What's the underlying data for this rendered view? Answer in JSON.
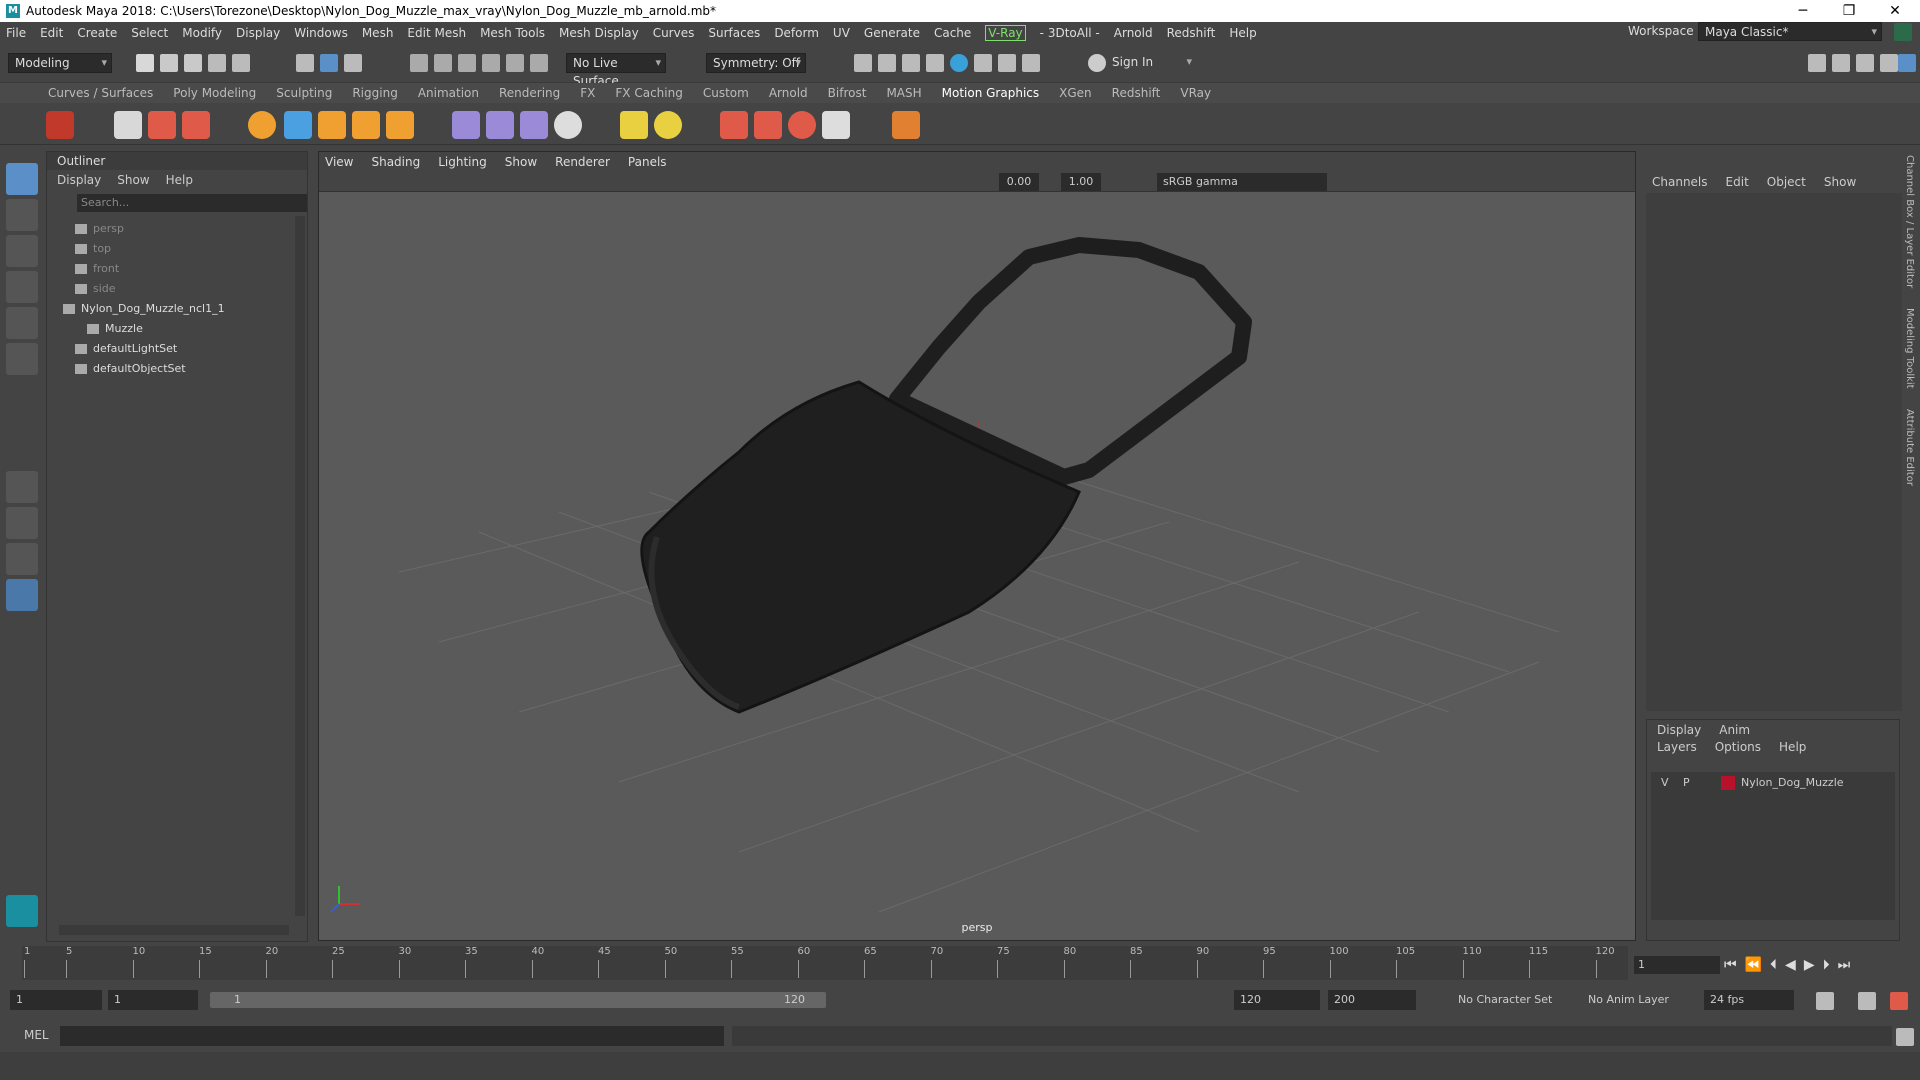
{
  "window": {
    "title": "Autodesk Maya 2018: C:\\Users\\Torezone\\Desktop\\Nylon_Dog_Muzzle_max_vray\\Nylon_Dog_Muzzle_mb_arnold.mb*",
    "logo": "M",
    "minimize": "─",
    "maximize": "❐",
    "close": "✕"
  },
  "menu": [
    "File",
    "Edit",
    "Create",
    "Select",
    "Modify",
    "Display",
    "Windows",
    "Mesh",
    "Edit Mesh",
    "Mesh Tools",
    "Mesh Display",
    "Curves",
    "Surfaces",
    "Deform",
    "UV",
    "Generate",
    "Cache",
    "V-Ray",
    "- 3DtoAll -",
    "Arnold",
    "Redshift",
    "Help"
  ],
  "workspace": {
    "label": "Workspace :",
    "value": "Maya Classic*"
  },
  "status": {
    "mode": "Modeling",
    "live_surface": "No Live Surface",
    "symmetry": "Symmetry: Off",
    "sign_in": "Sign In"
  },
  "shelf_tabs": [
    "Curves / Surfaces",
    "Poly Modeling",
    "Sculpting",
    "Rigging",
    "Animation",
    "Rendering",
    "FX",
    "FX Caching",
    "Custom",
    "Arnold",
    "Bifrost",
    "MASH",
    "Motion Graphics",
    "XGen",
    "Redshift",
    "VRay"
  ],
  "shelf_active": "Motion Graphics",
  "outliner": {
    "title": "Outliner",
    "menu": [
      "Display",
      "Show",
      "Help"
    ],
    "search_placeholder": "Search...",
    "items": [
      {
        "label": "persp",
        "indent": 1,
        "dim": true
      },
      {
        "label": "top",
        "indent": 1,
        "dim": true
      },
      {
        "label": "front",
        "indent": 1,
        "dim": true
      },
      {
        "label": "side",
        "indent": 1,
        "dim": true
      },
      {
        "label": "Nylon_Dog_Muzzle_ncl1_1",
        "indent": 0,
        "dim": false
      },
      {
        "label": "Muzzle",
        "indent": 2,
        "dim": false
      },
      {
        "label": "defaultLightSet",
        "indent": 1,
        "dim": false
      },
      {
        "label": "defaultObjectSet",
        "indent": 1,
        "dim": false
      }
    ]
  },
  "viewport": {
    "menu": [
      "View",
      "Shading",
      "Lighting",
      "Show",
      "Renderer",
      "Panels"
    ],
    "exposure": "0.00",
    "gamma": "1.00",
    "color_space": "sRGB gamma",
    "camera": "persp"
  },
  "channelbox": {
    "menu": [
      "Channels",
      "Edit",
      "Object",
      "Show"
    ],
    "side_tabs": [
      "Channel Box / Layer Editor",
      "Modeling Toolkit",
      "Attribute Editor"
    ]
  },
  "layers": {
    "tabs": [
      "Display",
      "Anim"
    ],
    "menu": [
      "Layers",
      "Options",
      "Help"
    ],
    "row": {
      "v": "V",
      "p": "P",
      "name": "Nylon_Dog_Muzzle",
      "color": "#b8122a"
    }
  },
  "timeline": {
    "ticks": [
      "5",
      "10",
      "15",
      "20",
      "25",
      "30",
      "35",
      "40",
      "45",
      "50",
      "55",
      "60",
      "65",
      "70",
      "75",
      "80",
      "85",
      "90",
      "95",
      "100",
      "105",
      "110",
      "115",
      "120"
    ],
    "start_tick": "1",
    "current": "1"
  },
  "range": {
    "start": "1",
    "anim_start": "1",
    "range_start": "1",
    "range_end": "120",
    "end": "120",
    "anim_end": "200",
    "char_set": "No Character Set",
    "anim_layer": "No Anim Layer",
    "fps": "24 fps"
  },
  "cmd": {
    "label": "MEL"
  }
}
